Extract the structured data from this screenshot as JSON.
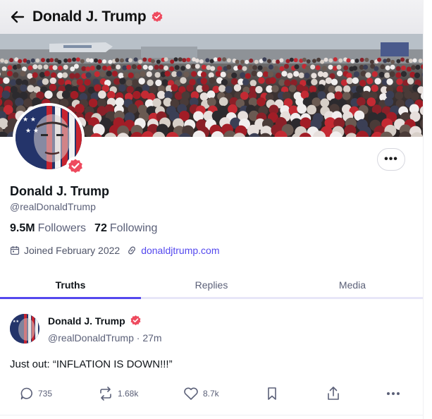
{
  "header": {
    "back_icon": "arrow-left-icon",
    "title": "Donald J. Trump",
    "verified_icon": "verified-badge-icon"
  },
  "profile": {
    "name": "Donald J. Trump",
    "handle": "@realDonaldTrump",
    "followers_count": "9.5M",
    "followers_label": "Followers",
    "following_count": "72",
    "following_label": "Following",
    "joined": "Joined February 2022",
    "website": "donaldjtrump.com",
    "more_label": "•••"
  },
  "tabs": [
    {
      "label": "Truths",
      "active": true
    },
    {
      "label": "Replies",
      "active": false
    },
    {
      "label": "Media",
      "active": false
    }
  ],
  "post": {
    "author_name": "Donald J. Trump",
    "author_handle": "@realDonaldTrump",
    "separator": "·",
    "time": "27m",
    "text": "Just out: “INFLATION IS DOWN!!!”",
    "replies": "735",
    "retruths": "1.68k",
    "likes": "8.7k"
  },
  "colors": {
    "accent": "#5448ee",
    "verified": "#ee4a5e",
    "muted_text": "#5b6078"
  }
}
